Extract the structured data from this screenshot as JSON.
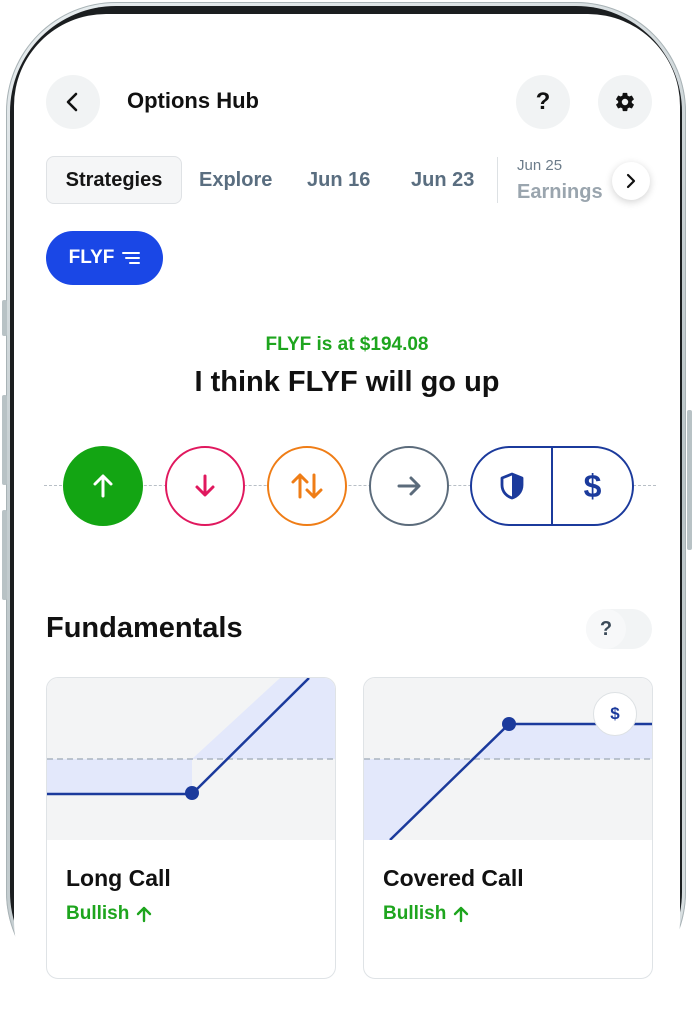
{
  "header": {
    "title": "Options Hub",
    "help_icon_label": "?"
  },
  "tabs": {
    "active": "Strategies",
    "explore": "Explore",
    "date1": "Jun 16",
    "date2": "Jun 23",
    "date3_small": "Jun 25",
    "date3_label": "Earnings"
  },
  "ticker": {
    "symbol": "FLYF",
    "price_text": "FLYF is at $194.08",
    "headline": "I think FLYF will go up"
  },
  "directions": {
    "up": {
      "icon": "arrow-up-icon",
      "color": "#13a513",
      "selected": true
    },
    "down": {
      "icon": "arrow-down-icon",
      "color": "#e0185e"
    },
    "volatile": {
      "icon": "arrows-up-down-icon",
      "color": "#ef7d16"
    },
    "neutral": {
      "icon": "arrow-right-icon",
      "color": "#5b6b7b"
    },
    "hedge": {
      "icon": "shield-icon",
      "color": "#1b3a9c"
    },
    "income": {
      "icon": "dollar-icon",
      "label": "$",
      "color": "#1b3a9c"
    }
  },
  "fundamentals": {
    "title": "Fundamentals",
    "help_label": "?",
    "cards": [
      {
        "title": "Long Call",
        "sentiment": "Bullish"
      },
      {
        "title": "Covered Call",
        "sentiment": "Bullish",
        "badge": "$"
      }
    ]
  },
  "colors": {
    "accent": "#1a47e6",
    "bullish": "#1ea51e",
    "navy": "#1b3a9c"
  }
}
